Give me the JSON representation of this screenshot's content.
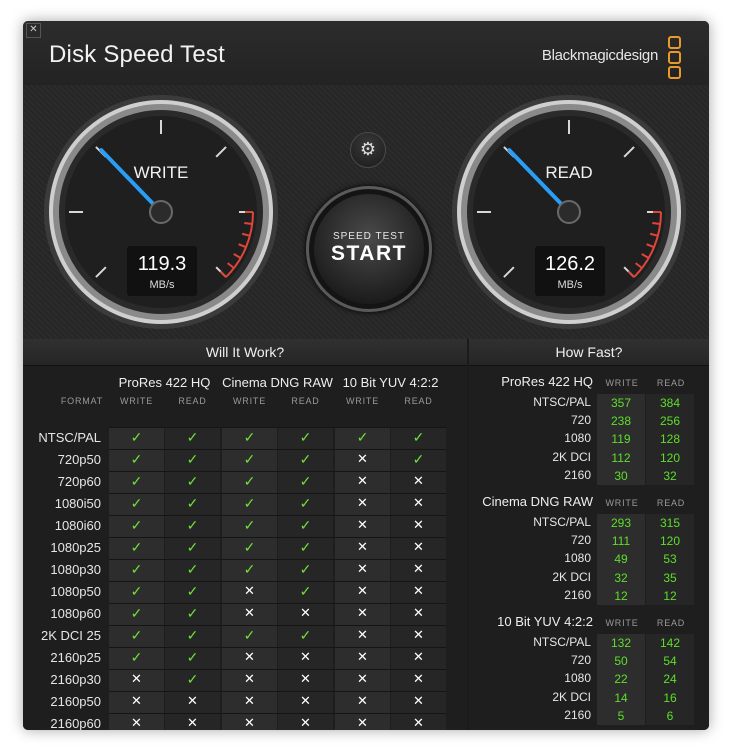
{
  "app": {
    "title": "Disk Speed Test",
    "brand": "Blackmagicdesign",
    "close_glyph": "✕"
  },
  "write_gauge": {
    "label": "WRITE",
    "value": "119.3",
    "unit": "MB/s"
  },
  "read_gauge": {
    "label": "READ",
    "value": "126.2",
    "unit": "MB/s"
  },
  "start_button": {
    "sub": "SPEED TEST",
    "main": "START"
  },
  "settings_icon": "gear-icon",
  "colors": {
    "check": "#6fe03a",
    "value": "#5ddf2a",
    "redline": "#e0453a",
    "needle": "#2a9df4"
  },
  "will_it_work": {
    "title": "Will It Work?",
    "format_label": "FORMAT",
    "groups": [
      "ProRes 422 HQ",
      "Cinema DNG RAW",
      "10 Bit YUV 4:2:2"
    ],
    "subheads": [
      "WRITE",
      "READ",
      "WRITE",
      "READ",
      "WRITE",
      "READ"
    ],
    "rows": [
      {
        "label": "NTSC/PAL",
        "cells": [
          "✓",
          "✓",
          "✓",
          "✓",
          "✓",
          "✓"
        ]
      },
      {
        "label": "720p50",
        "cells": [
          "✓",
          "✓",
          "✓",
          "✓",
          "✕",
          "✓"
        ]
      },
      {
        "label": "720p60",
        "cells": [
          "✓",
          "✓",
          "✓",
          "✓",
          "✕",
          "✕"
        ]
      },
      {
        "label": "1080i50",
        "cells": [
          "✓",
          "✓",
          "✓",
          "✓",
          "✕",
          "✕"
        ]
      },
      {
        "label": "1080i60",
        "cells": [
          "✓",
          "✓",
          "✓",
          "✓",
          "✕",
          "✕"
        ]
      },
      {
        "label": "1080p25",
        "cells": [
          "✓",
          "✓",
          "✓",
          "✓",
          "✕",
          "✕"
        ]
      },
      {
        "label": "1080p30",
        "cells": [
          "✓",
          "✓",
          "✓",
          "✓",
          "✕",
          "✕"
        ]
      },
      {
        "label": "1080p50",
        "cells": [
          "✓",
          "✓",
          "✕",
          "✓",
          "✕",
          "✕"
        ]
      },
      {
        "label": "1080p60",
        "cells": [
          "✓",
          "✓",
          "✕",
          "✕",
          "✕",
          "✕"
        ]
      },
      {
        "label": "2K DCI 25",
        "cells": [
          "✓",
          "✓",
          "✓",
          "✓",
          "✕",
          "✕"
        ]
      },
      {
        "label": "2160p25",
        "cells": [
          "✓",
          "✓",
          "✕",
          "✕",
          "✕",
          "✕"
        ]
      },
      {
        "label": "2160p30",
        "cells": [
          "✕",
          "✓",
          "✕",
          "✕",
          "✕",
          "✕"
        ]
      },
      {
        "label": "2160p50",
        "cells": [
          "✕",
          "✕",
          "✕",
          "✕",
          "✕",
          "✕"
        ]
      },
      {
        "label": "2160p60",
        "cells": [
          "✕",
          "✕",
          "✕",
          "✕",
          "✕",
          "✕"
        ]
      }
    ]
  },
  "how_fast": {
    "title": "How Fast?",
    "sections": [
      {
        "name": "ProRes 422 HQ",
        "write_label": "WRITE",
        "read_label": "READ",
        "rows": [
          {
            "label": "NTSC/PAL",
            "write": "357",
            "read": "384"
          },
          {
            "label": "720",
            "write": "238",
            "read": "256"
          },
          {
            "label": "1080",
            "write": "119",
            "read": "128"
          },
          {
            "label": "2K DCI",
            "write": "112",
            "read": "120"
          },
          {
            "label": "2160",
            "write": "30",
            "read": "32"
          }
        ]
      },
      {
        "name": "Cinema DNG RAW",
        "write_label": "WRITE",
        "read_label": "READ",
        "rows": [
          {
            "label": "NTSC/PAL",
            "write": "293",
            "read": "315"
          },
          {
            "label": "720",
            "write": "111",
            "read": "120"
          },
          {
            "label": "1080",
            "write": "49",
            "read": "53"
          },
          {
            "label": "2K DCI",
            "write": "32",
            "read": "35"
          },
          {
            "label": "2160",
            "write": "12",
            "read": "12"
          }
        ]
      },
      {
        "name": "10 Bit YUV 4:2:2",
        "write_label": "WRITE",
        "read_label": "READ",
        "rows": [
          {
            "label": "NTSC/PAL",
            "write": "132",
            "read": "142"
          },
          {
            "label": "720",
            "write": "50",
            "read": "54"
          },
          {
            "label": "1080",
            "write": "22",
            "read": "24"
          },
          {
            "label": "2K DCI",
            "write": "14",
            "read": "16"
          },
          {
            "label": "2160",
            "write": "5",
            "read": "6"
          }
        ]
      }
    ]
  }
}
